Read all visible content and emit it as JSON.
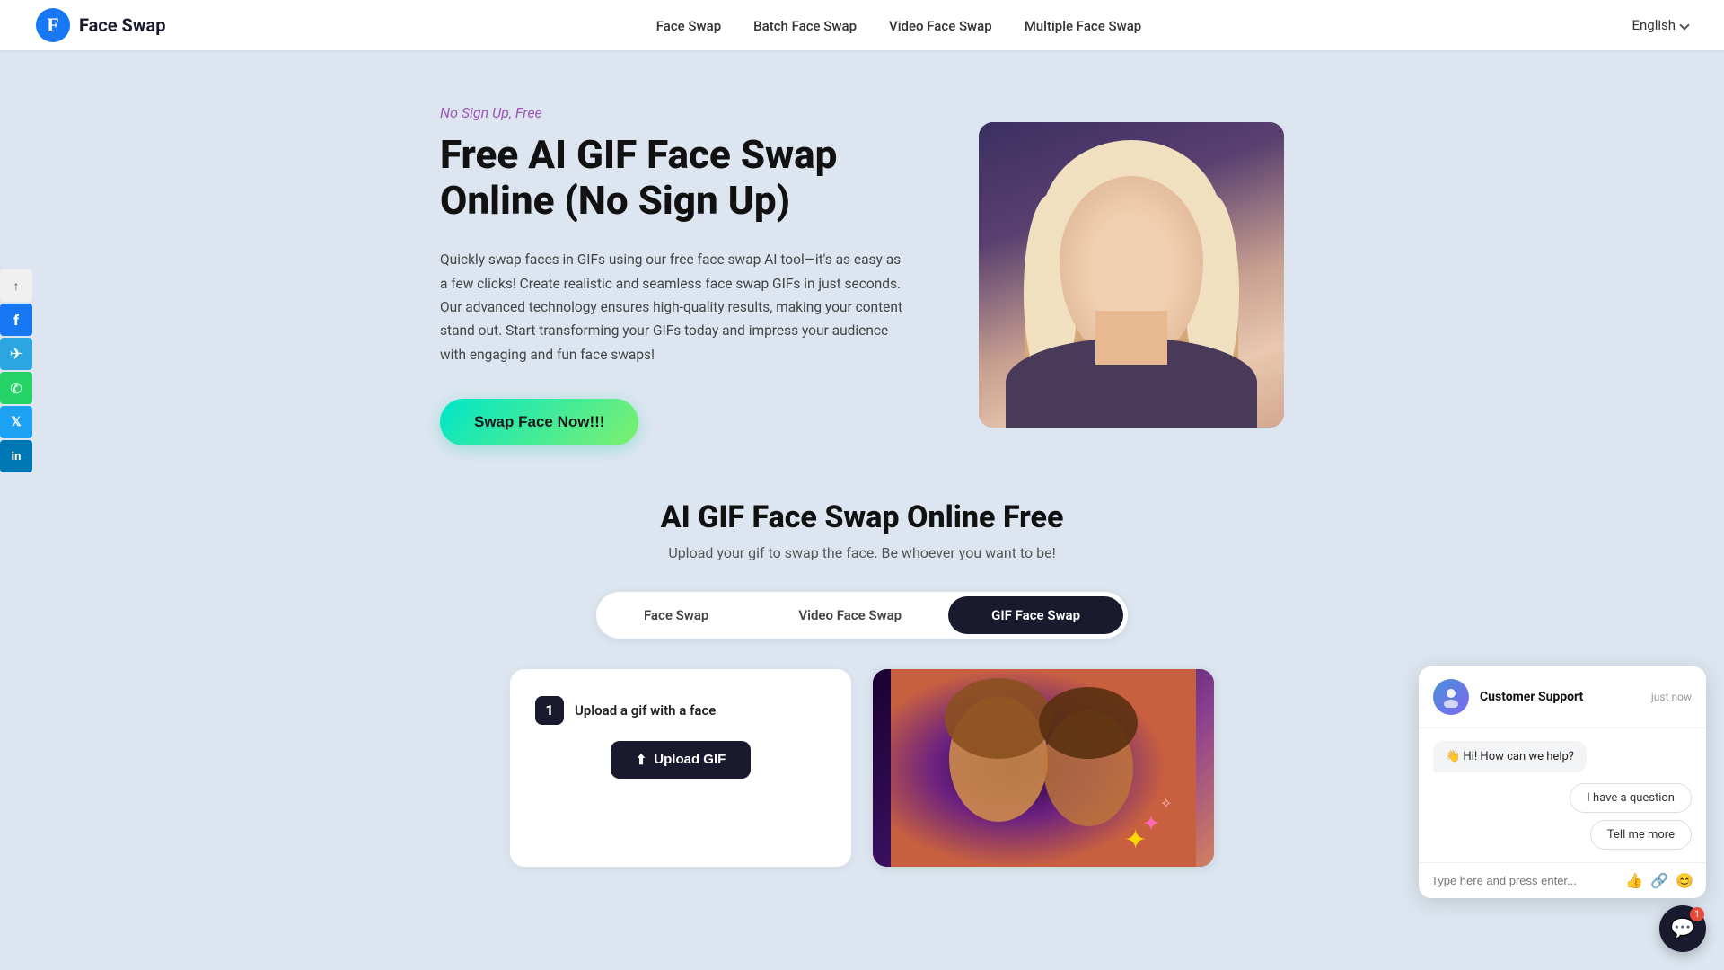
{
  "brand": {
    "logo_letter": "f",
    "title": "Face Swap"
  },
  "navbar": {
    "links": [
      {
        "label": "Face Swap",
        "id": "nav-face-swap"
      },
      {
        "label": "Batch Face Swap",
        "id": "nav-batch"
      },
      {
        "label": "Video Face Swap",
        "id": "nav-video"
      },
      {
        "label": "Multiple Face Swap",
        "id": "nav-multiple"
      }
    ],
    "language": "English"
  },
  "social": [
    {
      "name": "share",
      "icon": "↑",
      "label": "Share"
    },
    {
      "name": "facebook",
      "icon": "f",
      "label": "Facebook"
    },
    {
      "name": "telegram",
      "icon": "✈",
      "label": "Telegram"
    },
    {
      "name": "whatsapp",
      "icon": "✆",
      "label": "WhatsApp"
    },
    {
      "name": "twitter",
      "icon": "𝕏",
      "label": "Twitter"
    },
    {
      "name": "linkedin",
      "icon": "in",
      "label": "LinkedIn"
    }
  ],
  "hero": {
    "tag": "No Sign Up, Free",
    "title": "Free AI GIF Face Swap Online (No Sign Up)",
    "description": "Quickly swap faces in GIFs using our free face swap AI tool—it's as easy as a few clicks! Create realistic and seamless face swap GIFs in just seconds. Our advanced technology ensures high-quality results, making your content stand out. Start transforming your GIFs today and impress your audience with engaging and fun face swaps!",
    "cta_label": "Swap Face Now!!!"
  },
  "section": {
    "title": "AI GIF Face Swap Online Free",
    "subtitle": "Upload your gif to swap the face. Be whoever you want to be!"
  },
  "tabs": [
    {
      "label": "Face Swap",
      "id": "tab-face-swap",
      "active": false
    },
    {
      "label": "Video Face Swap",
      "id": "tab-video",
      "active": false
    },
    {
      "label": "GIF Face Swap",
      "id": "tab-gif",
      "active": true
    }
  ],
  "upload": {
    "step": "1",
    "label": "Upload a gif with a face",
    "btn_label": "Upload GIF",
    "btn_icon": "⬆"
  },
  "chat": {
    "agent_name": "Customer Support",
    "time": "just now",
    "greeting": "👋 Hi! How can we help?",
    "quick_reply_1": "I have a question",
    "quick_reply_2": "Tell me more",
    "input_placeholder": "Type here and press enter...",
    "badge_count": "1"
  }
}
